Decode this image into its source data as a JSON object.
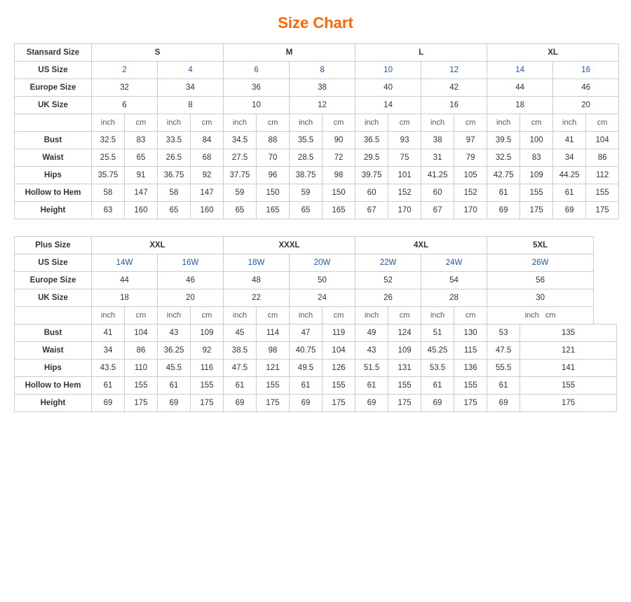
{
  "title": "Size Chart",
  "standard": {
    "section_label": "Stansard Size",
    "size_groups": [
      "S",
      "M",
      "L",
      "XL"
    ],
    "us_size_label": "US Size",
    "eu_size_label": "Europe Size",
    "uk_size_label": "UK Size",
    "us_sizes": [
      "2",
      "4",
      "6",
      "8",
      "10",
      "12",
      "14",
      "16"
    ],
    "eu_sizes": [
      "32",
      "34",
      "36",
      "38",
      "40",
      "42",
      "44",
      "46"
    ],
    "uk_sizes": [
      "6",
      "8",
      "10",
      "12",
      "14",
      "16",
      "18",
      "20"
    ],
    "measurements": [
      {
        "label": "Bust",
        "values": [
          "32.5",
          "83",
          "33.5",
          "84",
          "34.5",
          "88",
          "35.5",
          "90",
          "36.5",
          "93",
          "38",
          "97",
          "39.5",
          "100",
          "41",
          "104"
        ]
      },
      {
        "label": "Waist",
        "values": [
          "25.5",
          "65",
          "26.5",
          "68",
          "27.5",
          "70",
          "28.5",
          "72",
          "29.5",
          "75",
          "31",
          "79",
          "32.5",
          "83",
          "34",
          "86"
        ]
      },
      {
        "label": "Hips",
        "values": [
          "35.75",
          "91",
          "36.75",
          "92",
          "37.75",
          "96",
          "38.75",
          "98",
          "39.75",
          "101",
          "41.25",
          "105",
          "42.75",
          "109",
          "44.25",
          "112"
        ]
      },
      {
        "label": "Hollow to Hem",
        "values": [
          "58",
          "147",
          "58",
          "147",
          "59",
          "150",
          "59",
          "150",
          "60",
          "152",
          "60",
          "152",
          "61",
          "155",
          "61",
          "155"
        ]
      },
      {
        "label": "Height",
        "values": [
          "63",
          "160",
          "65",
          "160",
          "65",
          "165",
          "65",
          "165",
          "67",
          "170",
          "67",
          "170",
          "69",
          "175",
          "69",
          "175"
        ]
      }
    ]
  },
  "plus": {
    "section_label": "Plus Size",
    "size_groups": [
      "XXL",
      "XXXL",
      "4XL",
      "5XL"
    ],
    "us_size_label": "US Size",
    "eu_size_label": "Europe Size",
    "uk_size_label": "UK Size",
    "us_sizes": [
      "14W",
      "16W",
      "18W",
      "20W",
      "22W",
      "24W",
      "26W"
    ],
    "eu_sizes": [
      "44",
      "46",
      "48",
      "50",
      "52",
      "54",
      "56"
    ],
    "uk_sizes": [
      "18",
      "20",
      "22",
      "24",
      "26",
      "28",
      "30"
    ],
    "measurements": [
      {
        "label": "Bust",
        "values": [
          "41",
          "104",
          "43",
          "109",
          "45",
          "114",
          "47",
          "119",
          "49",
          "124",
          "51",
          "130",
          "53",
          "135"
        ]
      },
      {
        "label": "Waist",
        "values": [
          "34",
          "86",
          "36.25",
          "92",
          "38.5",
          "98",
          "40.75",
          "104",
          "43",
          "109",
          "45.25",
          "115",
          "47.5",
          "121"
        ]
      },
      {
        "label": "Hips",
        "values": [
          "43.5",
          "110",
          "45.5",
          "116",
          "47.5",
          "121",
          "49.5",
          "126",
          "51.5",
          "131",
          "53.5",
          "136",
          "55.5",
          "141"
        ]
      },
      {
        "label": "Hollow to Hem",
        "values": [
          "61",
          "155",
          "61",
          "155",
          "61",
          "155",
          "61",
          "155",
          "61",
          "155",
          "61",
          "155",
          "61",
          "155"
        ]
      },
      {
        "label": "Height",
        "values": [
          "69",
          "175",
          "69",
          "175",
          "69",
          "175",
          "69",
          "175",
          "69",
          "175",
          "69",
          "175",
          "69",
          "175"
        ]
      }
    ]
  }
}
